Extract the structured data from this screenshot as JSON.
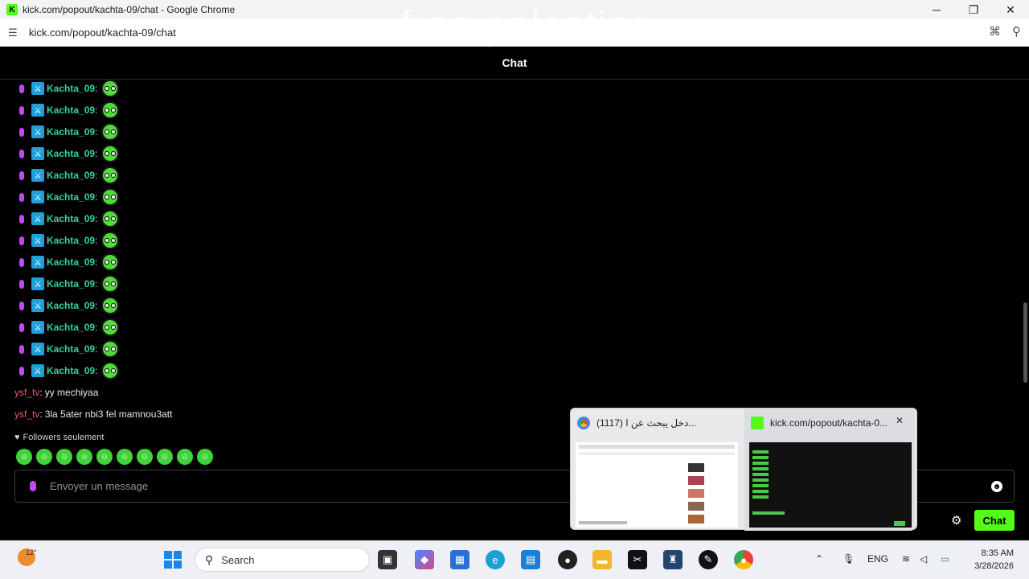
{
  "window": {
    "title": "kick.com/popout/kachta-09/chat - Google Chrome",
    "minimize": "─",
    "maximize": "❐",
    "close": "✕"
  },
  "watermark": "free palestine",
  "address": {
    "url": "kick.com/popout/kachta-09/chat"
  },
  "chat": {
    "header": "Chat",
    "repeat_user": "Kachta_09",
    "colon": ":",
    "repeat_count": 14,
    "messages": [
      {
        "user": "ysf_tv",
        "text": "yy mechiyaa"
      },
      {
        "user": "ysf_tv",
        "text": "3la 5ater nbi3 fel mamnou3att"
      }
    ],
    "followers_only": "Followers seulement",
    "input_placeholder": "Envoyer un message",
    "send_button": "Chat"
  },
  "preview": {
    "tab1_title": "(1117) دخل يبحث عن ا...",
    "tab2_title": "kick.com/popout/kachta-0..."
  },
  "taskbar": {
    "temp": "12°",
    "search": "Search",
    "lang": "ENG",
    "time": "8:35 AM",
    "date": "3/28/2026"
  },
  "colors": {
    "kick_green": "#53fc18",
    "username_teal": "#35d39e",
    "username_red": "#f05a66"
  }
}
